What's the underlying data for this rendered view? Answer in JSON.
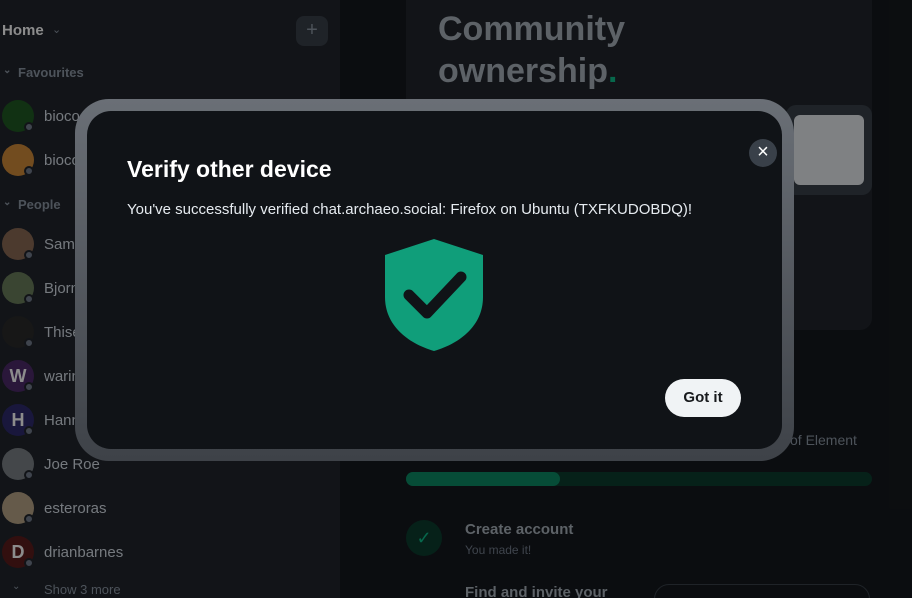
{
  "sidebar": {
    "home_title": "Home",
    "add_label": "+",
    "favourites_label": "Favourites",
    "people_label": "People",
    "favourites": [
      {
        "name": "bioco",
        "avatar_color": "#1f5a23",
        "avatar_letter": ""
      },
      {
        "name": "bioco",
        "avatar_color": "#d08a3a",
        "avatar_letter": ""
      }
    ],
    "people": [
      {
        "name": "Sam",
        "avatar_color": "#8a6a55",
        "avatar_letter": ""
      },
      {
        "name": "Bjorn",
        "avatar_color": "#6b7e5c",
        "avatar_letter": ""
      },
      {
        "name": "Thise",
        "avatar_color": "#2a2a2a",
        "avatar_letter": ""
      },
      {
        "name": "warin",
        "avatar_color": "#4e2a6a",
        "avatar_letter": "W"
      },
      {
        "name": "Hann",
        "avatar_color": "#2e2a6e",
        "avatar_letter": "H"
      },
      {
        "name": "Joe Roe",
        "avatar_color": "#7c8288",
        "avatar_letter": ""
      },
      {
        "name": "esteroras",
        "avatar_color": "#b9a487",
        "avatar_letter": ""
      },
      {
        "name": "drianbarnes",
        "avatar_color": "#5c1c1c",
        "avatar_letter": "D"
      }
    ],
    "show_more": "Show 3 more"
  },
  "main": {
    "hero_title": "Community ownership",
    "hero_title_dot": ".",
    "progress_sub": "of Element",
    "progress_fraction": 0.33,
    "task1_title": "Create account",
    "task1_sub": "You made it!",
    "task2_title": "Find and invite your"
  },
  "dialog": {
    "title": "Verify other device",
    "message": "You've successfully verified chat.archaeo.social: Firefox on Ubuntu (TXFKUDOBDQ)!",
    "close_icon": "×",
    "confirm_label": "Got it",
    "shield_color": "#109e7a"
  },
  "colors": {
    "accent": "#0dbd8b"
  }
}
